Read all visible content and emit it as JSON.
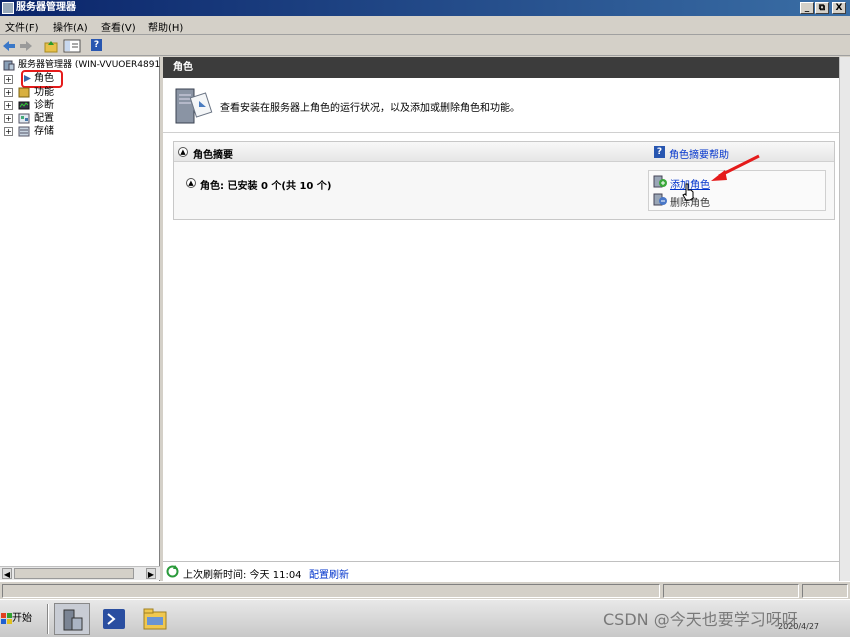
{
  "window": {
    "title": "服务器管理器",
    "controls": {
      "minimize": "_",
      "restore": "⧉",
      "close": "X"
    }
  },
  "menubar": [
    {
      "label": "文件(F)"
    },
    {
      "label": "操作(A)"
    },
    {
      "label": "查看(V)"
    },
    {
      "label": "帮助(H)"
    }
  ],
  "toolbar": {
    "icons": [
      "back-icon",
      "forward-icon",
      "up-folder-icon",
      "show-hide-console-tree-icon",
      "help-icon"
    ],
    "help_glyph": "?"
  },
  "tree": {
    "root": "服务器管理器 (WIN-VVUOER4891",
    "items": [
      {
        "label": "角色",
        "selected": true,
        "expander": "+"
      },
      {
        "label": "功能",
        "expander": "+"
      },
      {
        "label": "诊断",
        "expander": "+"
      },
      {
        "label": "配置",
        "expander": "+"
      },
      {
        "label": "存储",
        "expander": "+"
      }
    ]
  },
  "main": {
    "header": "角色",
    "intro_text": "查看安装在服务器上角色的运行状况，以及添加或删除角色和功能。",
    "section": {
      "title": "角色摘要",
      "help_link": "角色摘要帮助",
      "roles_line": "角色: 已安装 0 个(共 10 个)",
      "actions": {
        "add_roles": "添加角色",
        "remove_roles": "删除角色"
      }
    },
    "refresh": {
      "label": "上次刷新时间: 今天 11:04",
      "config_link": "配置刷新"
    }
  },
  "taskbar": {
    "start_label": "开始",
    "apps": [
      "server-manager-icon",
      "powershell-icon",
      "explorer-icon"
    ],
    "clock_date": "2020/4/27"
  },
  "watermark": "CSDN @今天也要学习呀呀",
  "colors": {
    "highlight_box": "#e51b1b",
    "arrow": "#e51b1b",
    "header_bg": "#3c3c3c",
    "link": "#0033cc"
  }
}
